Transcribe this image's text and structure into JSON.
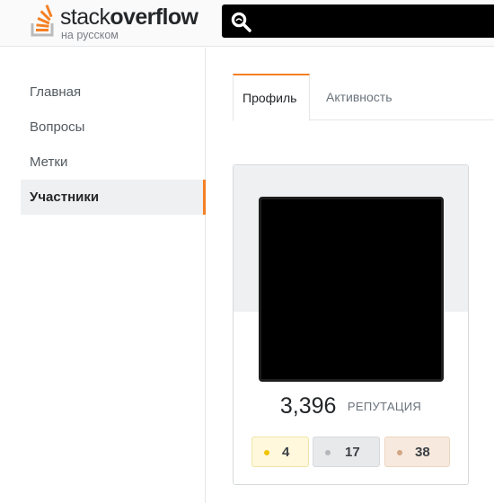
{
  "header": {
    "logo": {
      "text_light": "stack",
      "text_bold": "overflow",
      "subtitle": "на русском",
      "icon": "stackoverflow-logo-icon"
    },
    "search": {
      "icon": "search-icon",
      "value": "",
      "placeholder": ""
    }
  },
  "sidebar": {
    "items": [
      {
        "label": "Главная",
        "active": false
      },
      {
        "label": "Вопросы",
        "active": false
      },
      {
        "label": "Метки",
        "active": false
      },
      {
        "label": "Участники",
        "active": true
      }
    ]
  },
  "tabs": [
    {
      "label": "Профиль",
      "active": true
    },
    {
      "label": "Активность",
      "active": false
    }
  ],
  "profile": {
    "reputation_value": "3,396",
    "reputation_label": "РЕПУТАЦИЯ",
    "badges": {
      "gold": {
        "count": "4",
        "color": "#f2c300"
      },
      "silver": {
        "count": "17",
        "color": "#b4b8bc"
      },
      "bronze": {
        "count": "38",
        "color": "#d1a684"
      }
    }
  },
  "colors": {
    "accent": "#f48024",
    "text": "#242729",
    "muted": "#6a737c"
  }
}
